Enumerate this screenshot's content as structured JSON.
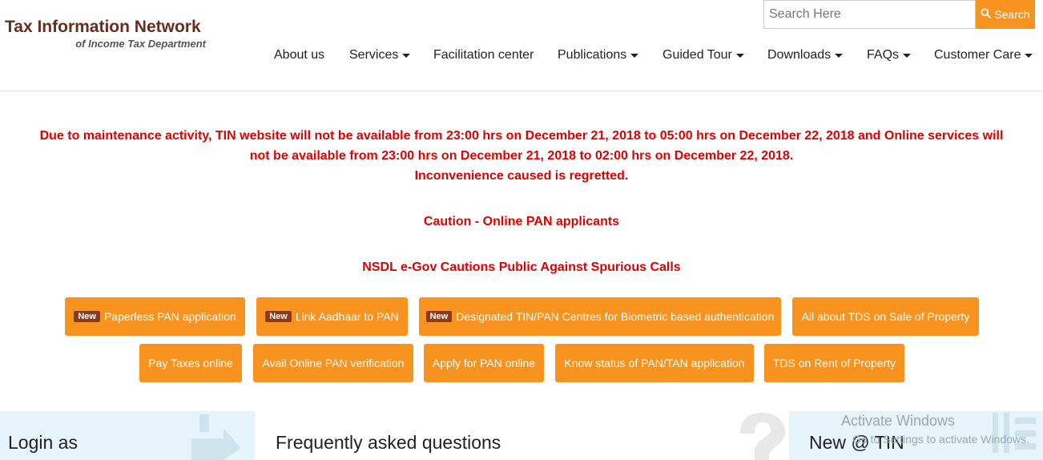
{
  "brand": {
    "title": "Tax Information Network",
    "subtitle": "of Income Tax Department"
  },
  "search": {
    "placeholder": "Search Here",
    "button_label": "Search"
  },
  "nav": [
    {
      "label": "About us"
    },
    {
      "label": "Services"
    },
    {
      "label": "Facilitation center"
    },
    {
      "label": "Publications"
    },
    {
      "label": "Guided Tour"
    },
    {
      "label": "Downloads"
    },
    {
      "label": "FAQs"
    },
    {
      "label": "Customer Care"
    }
  ],
  "notices": {
    "maintenance_line1": "Due to maintenance activity, TIN website will not be available from 23:00 hrs on December 21, 2018 to 05:00 hrs on December 22, 2018 and Online services will",
    "maintenance_line2": "not be available from 23:00 hrs on December 21, 2018 to 02:00 hrs on December 22, 2018.",
    "maintenance_line3": "Inconvenience caused is regretted.",
    "caution": "Caution - Online PAN applicants",
    "nsdl": "NSDL e-Gov Cautions Public Against Spurious Calls"
  },
  "badge_new": "New",
  "quick_links": [
    {
      "label": "Paperless PAN application"
    },
    {
      "label": "Link Aadhaar to PAN"
    },
    {
      "label": "Designated TIN/PAN Centres for Biometric based authentication"
    },
    {
      "label": "All about TDS on Sale of Property"
    },
    {
      "label": "Pay Taxes online"
    },
    {
      "label": "Avail Online PAN verification"
    },
    {
      "label": "Apply for PAN online"
    },
    {
      "label": "Know status of PAN/TAN application"
    },
    {
      "label": "TDS on Rent of Property"
    }
  ],
  "bottom": {
    "login_title": "Login as",
    "faq_title": "Frequently asked questions",
    "new_title": "New @ TIN"
  },
  "os_watermark": {
    "line1": "Activate Windows",
    "line2": "Go to Settings to activate Windows."
  },
  "colors": {
    "brand": "#6b2d1a",
    "accent": "#f7931e",
    "alert": "#e00000",
    "panel_bg": "#e6f4fb"
  }
}
